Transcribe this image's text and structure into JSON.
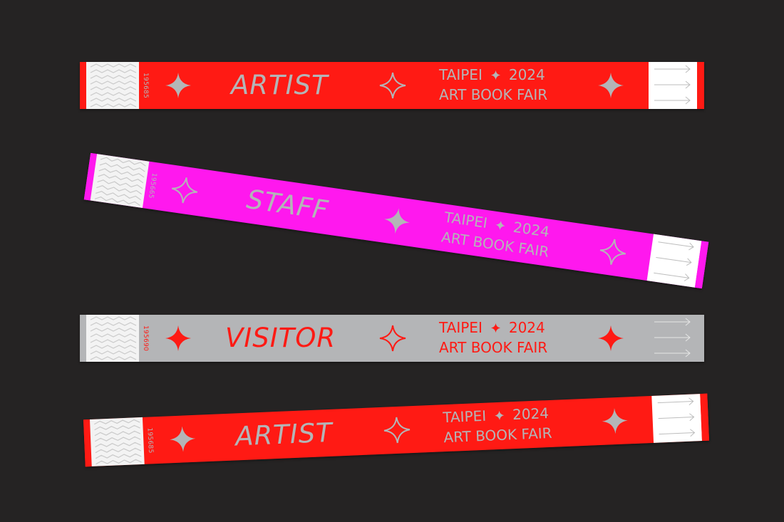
{
  "colors": {
    "background": "#252323",
    "red": "#ff1a14",
    "magenta": "#ff18ee",
    "grey": "#b4b5b7",
    "ink_silver": "#b4b5b7",
    "ink_red": "#ff1a14",
    "tab_white": "#f3f3f3"
  },
  "wristbands": [
    {
      "role": "ARTIST",
      "serial": "195685",
      "band_color": "red",
      "ink_color": "silver",
      "event_line1_left": "TAIPEI",
      "event_line1_right": "2024",
      "event_line2": "ART BOOK FAIR"
    },
    {
      "role": "STAFF",
      "serial": "195665",
      "band_color": "magenta",
      "ink_color": "silver",
      "event_line1_left": "TAIPEI",
      "event_line1_right": "2024",
      "event_line2": "ART BOOK FAIR"
    },
    {
      "role": "VISITOR",
      "serial": "195690",
      "band_color": "grey",
      "ink_color": "red",
      "event_line1_left": "TAIPEI",
      "event_line1_right": "2024",
      "event_line2": "ART BOOK FAIR"
    },
    {
      "role": "ARTIST",
      "serial": "195685",
      "band_color": "red",
      "ink_color": "silver",
      "event_line1_left": "TAIPEI",
      "event_line1_right": "2024",
      "event_line2": "ART BOOK FAIR"
    }
  ],
  "icons": {
    "sparkle": "four-point-star-icon",
    "arrow": "arrow-right-icon",
    "zigzag": "zigzag-security-pattern"
  }
}
